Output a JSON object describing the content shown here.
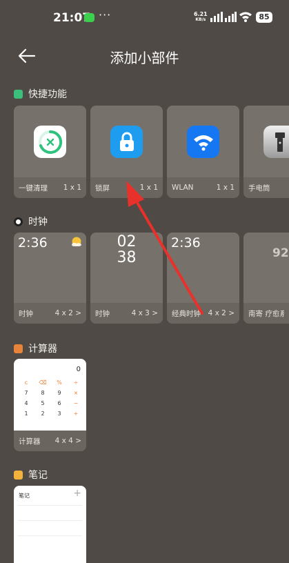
{
  "status_bar": {
    "time": "21:07",
    "dots": "···",
    "speed_value": "6.21",
    "speed_unit": "KB/s",
    "battery": "85"
  },
  "header": {
    "title": "添加小部件"
  },
  "sections": {
    "quick": {
      "title": "快捷功能",
      "color": "#3bbf7a",
      "items": [
        {
          "name": "一键清理",
          "size": "1 x 1",
          "icon": "cleanup-icon"
        },
        {
          "name": "锁屏",
          "size": "1 x 1",
          "icon": "lock-icon"
        },
        {
          "name": "WLAN",
          "size": "1 x 1",
          "icon": "wifi-icon"
        },
        {
          "name": "手电筒",
          "size": "",
          "icon": "flashlight-icon"
        }
      ]
    },
    "clock": {
      "title": "时钟",
      "items": [
        {
          "name": "时钟",
          "size": "4 x 2 >",
          "display": "2:36"
        },
        {
          "name": "时钟",
          "size": "4 x 3 >",
          "display_hour": "02",
          "display_min": "38"
        },
        {
          "name": "经典时钟",
          "size": "4 x 2 >",
          "display": "2:36"
        },
        {
          "name": "南寄 疗愈系",
          "size": "",
          "display": "92"
        }
      ]
    },
    "calculator": {
      "title": "计算器",
      "color": "#e8843a",
      "name": "计算器",
      "size": "4 x 4 >",
      "display": "0",
      "keys": [
        "c",
        "⌫",
        "%",
        "÷",
        "7",
        "8",
        "9",
        "×",
        "4",
        "5",
        "6",
        "−",
        "1",
        "2",
        "3",
        "+"
      ]
    },
    "notes": {
      "title": "笔记",
      "color": "#f2b23c",
      "widget_title": "笔记",
      "plus": "+"
    }
  },
  "colors": {
    "background": "#4f4a45",
    "card": "#77716b",
    "arrow": "#e8312a",
    "lock_blue": "#1e9df0",
    "wifi_blue": "#1677f2"
  }
}
